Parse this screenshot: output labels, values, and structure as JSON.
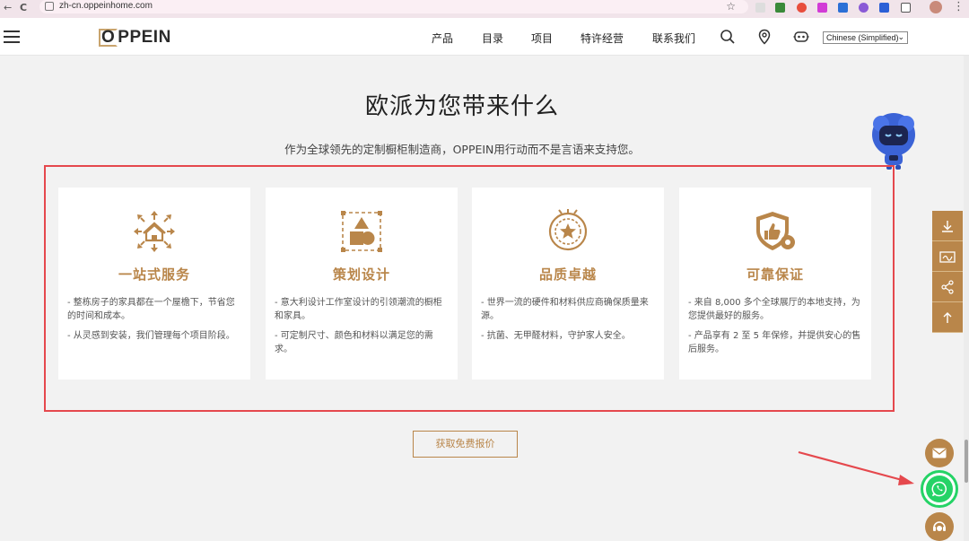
{
  "browser": {
    "url": "zh-cn.oppeinhome.com",
    "nav_back": "←",
    "nav_reload": "C",
    "bookmark_icon": "star-icon"
  },
  "header": {
    "logo": "OPPEIN",
    "menu": [
      "产品",
      "目录",
      "项目",
      "特许经营",
      "联系我们"
    ],
    "language": "Chinese (Simplified)",
    "icons": [
      "search-icon",
      "location-pin-icon",
      "chatbot-icon"
    ]
  },
  "section": {
    "title": "欧派为您带来什么",
    "subtitle": "作为全球领先的定制橱柜制造商，OPPEIN用行动而不是言语来支持您。"
  },
  "cards": [
    {
      "title": "一站式服务",
      "icon": "house-arrows-icon",
      "desc": [
        "- 整栋房子的家具都在一个屋檐下，节省您的时间和成本。",
        "- 从灵感到安装，我们管理每个项目阶段。"
      ]
    },
    {
      "title": "策划设计",
      "icon": "design-shapes-icon",
      "desc": [
        "- 意大利设计工作室设计的引领潮流的橱柜和家具。",
        "- 可定制尺寸、颜色和材料以满足您的需求。"
      ]
    },
    {
      "title": "品质卓越",
      "icon": "quality-medal-icon",
      "desc": [
        "- 世界一流的硬件和材料供应商确保质量来源。",
        "- 抗菌、无甲醛材料，守护家人安全。"
      ]
    },
    {
      "title": "可靠保证",
      "icon": "shield-thumbs-up-icon",
      "desc": [
        "- 来自 8,000 多个全球展厅的本地支持，为您提供最好的服务。",
        "- 产品享有 2 至 5 年保修，并提供安心的售后服务。"
      ]
    }
  ],
  "cta": {
    "label": "获取免费报价"
  },
  "side_toolbar": [
    "download-icon",
    "signature-icon",
    "share-icon",
    "arrow-up-icon"
  ],
  "floating": [
    "mail-icon",
    "whatsapp-icon",
    "customer-service-icon"
  ],
  "colors": {
    "accent": "#b9864a",
    "highlight_border": "#e5484d",
    "whatsapp": "#25d366",
    "background": "#f2f2f2"
  }
}
